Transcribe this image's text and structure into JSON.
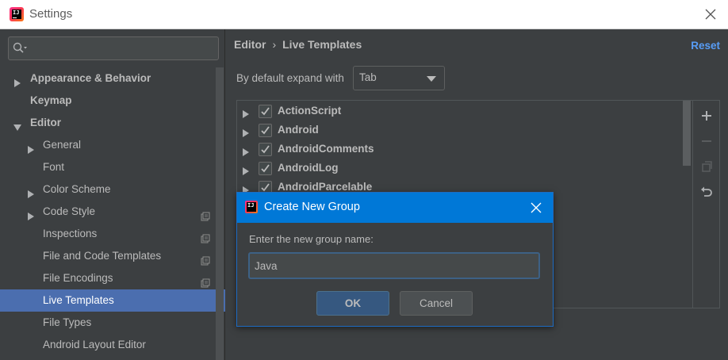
{
  "window": {
    "title": "Settings",
    "app_icon": "intellij-idea-icon",
    "close_icon": "close-icon"
  },
  "sidebar": {
    "search": {
      "placeholder": "",
      "icon": "search-icon"
    },
    "items": [
      {
        "label": "Appearance & Behavior",
        "bold": true,
        "expand": "collapsed",
        "indent": 0
      },
      {
        "label": "Keymap",
        "bold": true,
        "expand": "none",
        "indent": 0
      },
      {
        "label": "Editor",
        "bold": true,
        "expand": "expanded",
        "indent": 0
      },
      {
        "label": "General",
        "bold": false,
        "expand": "collapsed",
        "indent": 1
      },
      {
        "label": "Font",
        "bold": false,
        "expand": "none",
        "indent": 1
      },
      {
        "label": "Color Scheme",
        "bold": false,
        "expand": "collapsed",
        "indent": 1
      },
      {
        "label": "Code Style",
        "bold": false,
        "expand": "collapsed",
        "indent": 1,
        "project_icon": true
      },
      {
        "label": "Inspections",
        "bold": false,
        "expand": "none",
        "indent": 1,
        "project_icon": true
      },
      {
        "label": "File and Code Templates",
        "bold": false,
        "expand": "none",
        "indent": 1,
        "project_icon": true
      },
      {
        "label": "File Encodings",
        "bold": false,
        "expand": "none",
        "indent": 1,
        "project_icon": true
      },
      {
        "label": "Live Templates",
        "bold": false,
        "expand": "none",
        "indent": 1,
        "selected": true
      },
      {
        "label": "File Types",
        "bold": false,
        "expand": "none",
        "indent": 1
      },
      {
        "label": "Android Layout Editor",
        "bold": false,
        "expand": "none",
        "indent": 1
      }
    ]
  },
  "main": {
    "breadcrumb": {
      "parent": "Editor",
      "separator": "›",
      "current": "Live Templates"
    },
    "reset_label": "Reset",
    "expand_label": "By default expand with",
    "expand_value": "Tab",
    "template_groups": [
      {
        "label": "ActionScript",
        "checked": true
      },
      {
        "label": "Android",
        "checked": true
      },
      {
        "label": "AndroidComments",
        "checked": true
      },
      {
        "label": "AndroidLog",
        "checked": true
      },
      {
        "label": "AndroidParcelable",
        "checked": true
      }
    ],
    "toolbar": {
      "add_icon": "plus-icon",
      "remove_icon": "minus-icon",
      "copy_icon": "copy-icon",
      "undo_icon": "undo-icon"
    }
  },
  "dialog": {
    "title": "Create New Group",
    "prompt": "Enter the new group name:",
    "input_value": "Java",
    "ok_label": "OK",
    "cancel_label": "Cancel",
    "title_color": "#0078d7"
  }
}
